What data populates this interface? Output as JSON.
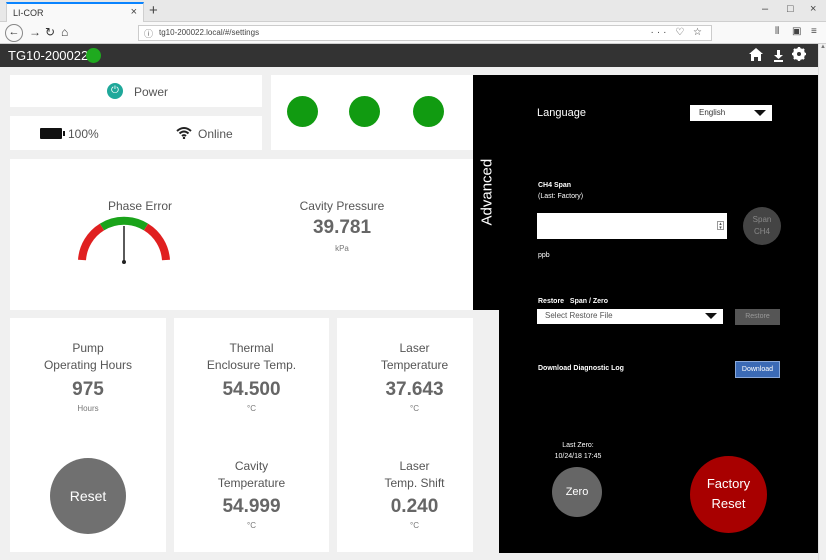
{
  "browser": {
    "tab_title": "LI-COR",
    "tab_close": "×",
    "new_tab": "+",
    "url": "tg10-200022.local/#/settings",
    "url_right": "··· ♡ ☆",
    "min": "–",
    "max": "□",
    "close": "×"
  },
  "app": {
    "title": "TG10-200022",
    "status_color": "#1faa1f"
  },
  "power": {
    "label": "Power"
  },
  "status": {
    "battery": "100%",
    "network": "Online"
  },
  "lights": {
    "count": 3,
    "color": "#119b11"
  },
  "phase_error": {
    "title": "Phase Error"
  },
  "cavity_pressure": {
    "title": "Cavity Pressure",
    "value": "39.781",
    "unit": "kPa"
  },
  "metrics": {
    "pump": {
      "title1": "Pump",
      "title2": "Operating Hours",
      "value": "975",
      "unit": "Hours"
    },
    "thermal": {
      "title1": "Thermal",
      "title2": "Enclosure Temp.",
      "value": "54.500",
      "unit": "°C"
    },
    "laser_temp": {
      "title1": "Laser",
      "title2": "Temperature",
      "value": "37.643",
      "unit": "°C"
    },
    "cavity_temp": {
      "title1": "Cavity",
      "title2": "Temperature",
      "value": "54.999",
      "unit": "°C"
    },
    "laser_shift": {
      "title1": "Laser",
      "title2": "Temp. Shift",
      "value": "0.240",
      "unit": "°C"
    }
  },
  "reset_button": "Reset",
  "advanced": {
    "tab_label": "Advanced",
    "language_label": "Language",
    "language_value": "English",
    "span_title": "CH4 Span",
    "span_last": "(Last: Factory)",
    "span_unit": "ppb",
    "span_button_1": "Span",
    "span_button_2": "CH4",
    "restore_label": "Restore   Span / Zero",
    "restore_placeholder": "Select Restore File",
    "restore_button": "Restore",
    "diag_label": "Download Diagnostic Log",
    "download_button": "Download",
    "last_zero_label": "Last Zero:",
    "last_zero_time": "10/24/18 17:45",
    "zero_button": "Zero",
    "factory_reset_1": "Factory",
    "factory_reset_2": "Reset"
  }
}
